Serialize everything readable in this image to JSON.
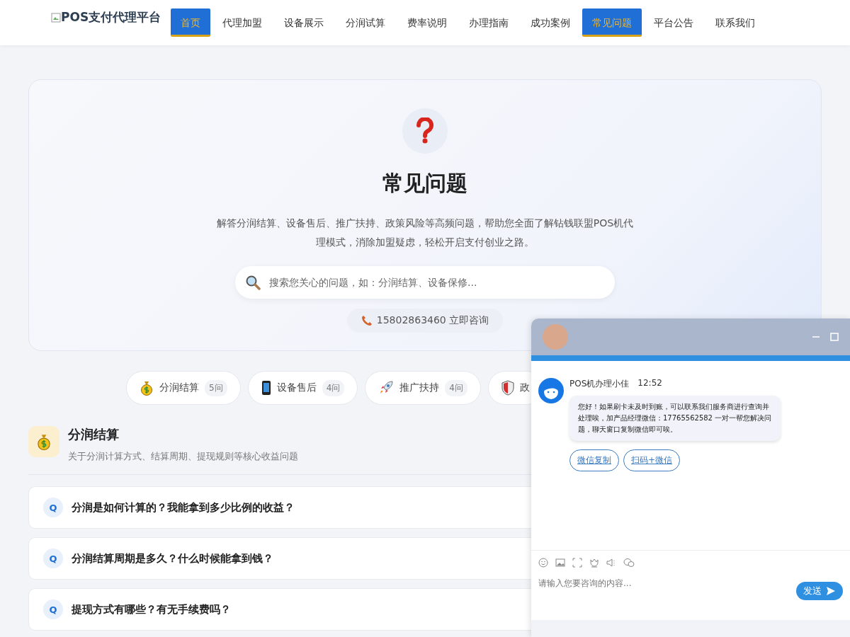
{
  "header": {
    "logo": "POS支付代理平台",
    "nav": [
      {
        "label": "首页",
        "selected": true
      },
      {
        "label": "代理加盟",
        "selected": false
      },
      {
        "label": "设备展示",
        "selected": false
      },
      {
        "label": "分润试算",
        "selected": false
      },
      {
        "label": "费率说明",
        "selected": false
      },
      {
        "label": "办理指南",
        "selected": false
      },
      {
        "label": "成功案例",
        "selected": false
      },
      {
        "label": "常见问题",
        "selected": true
      },
      {
        "label": "平台公告",
        "selected": false
      },
      {
        "label": "联系我们",
        "selected": false
      }
    ]
  },
  "hero": {
    "title": "常见问题",
    "description": "解答分润结算、设备售后、推广扶持、政策风险等高频问题，帮助您全面了解钻钱联盟POS机代理模式，消除加盟疑虑，轻松开启支付创业之路。",
    "search": {
      "placeholder": "搜索您关心的问题，如：分润结算、设备保修..."
    },
    "phone_button": "15802863460 立即咨询"
  },
  "categories": [
    {
      "kind": "money",
      "label": "分润结算",
      "count": "5问"
    },
    {
      "kind": "phone",
      "label": "设备售后",
      "count": "4问"
    },
    {
      "kind": "rocket",
      "label": "推广扶持",
      "count": "4问"
    },
    {
      "kind": "shield",
      "label": "政"
    }
  ],
  "section": {
    "title": "分润结算",
    "subtitle": "关于分润计算方式、结算周期、提现规则等核心收益问题"
  },
  "questions": [
    {
      "badge": "Q",
      "text": "分润是如何计算的？我能拿到多少比例的收益？"
    },
    {
      "badge": "Q",
      "text": "分润结算周期是多久？什么时候能拿到钱？"
    },
    {
      "badge": "Q",
      "text": "提现方式有哪些？有无手续费吗？"
    }
  ],
  "chat": {
    "sender": "POS机办理小佳",
    "time": "12:52",
    "message": "您好！如果刷卡未及时到账，可以联系我们服务商进行查询并处理唉，加产品经理微信：17765562582 一对一帮您解决问题，聊天窗口复制微信即可唉。",
    "links": [
      "微信复制",
      "扫码+微信"
    ],
    "input": {
      "placeholder": "请输入您要咨询的内容..."
    },
    "send": "发送"
  }
}
